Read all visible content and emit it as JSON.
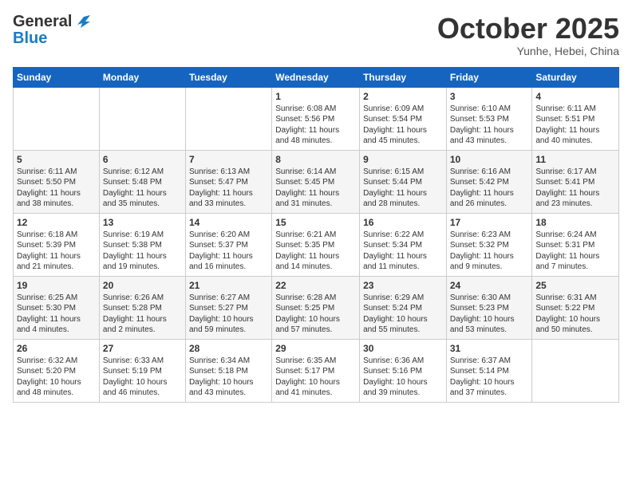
{
  "header": {
    "logo_line1": "General",
    "logo_line2": "Blue",
    "month": "October 2025",
    "location": "Yunhe, Hebei, China"
  },
  "weekdays": [
    "Sunday",
    "Monday",
    "Tuesday",
    "Wednesday",
    "Thursday",
    "Friday",
    "Saturday"
  ],
  "weeks": [
    [
      {
        "day": "",
        "info": ""
      },
      {
        "day": "",
        "info": ""
      },
      {
        "day": "",
        "info": ""
      },
      {
        "day": "1",
        "info": "Sunrise: 6:08 AM\nSunset: 5:56 PM\nDaylight: 11 hours\nand 48 minutes."
      },
      {
        "day": "2",
        "info": "Sunrise: 6:09 AM\nSunset: 5:54 PM\nDaylight: 11 hours\nand 45 minutes."
      },
      {
        "day": "3",
        "info": "Sunrise: 6:10 AM\nSunset: 5:53 PM\nDaylight: 11 hours\nand 43 minutes."
      },
      {
        "day": "4",
        "info": "Sunrise: 6:11 AM\nSunset: 5:51 PM\nDaylight: 11 hours\nand 40 minutes."
      }
    ],
    [
      {
        "day": "5",
        "info": "Sunrise: 6:11 AM\nSunset: 5:50 PM\nDaylight: 11 hours\nand 38 minutes."
      },
      {
        "day": "6",
        "info": "Sunrise: 6:12 AM\nSunset: 5:48 PM\nDaylight: 11 hours\nand 35 minutes."
      },
      {
        "day": "7",
        "info": "Sunrise: 6:13 AM\nSunset: 5:47 PM\nDaylight: 11 hours\nand 33 minutes."
      },
      {
        "day": "8",
        "info": "Sunrise: 6:14 AM\nSunset: 5:45 PM\nDaylight: 11 hours\nand 31 minutes."
      },
      {
        "day": "9",
        "info": "Sunrise: 6:15 AM\nSunset: 5:44 PM\nDaylight: 11 hours\nand 28 minutes."
      },
      {
        "day": "10",
        "info": "Sunrise: 6:16 AM\nSunset: 5:42 PM\nDaylight: 11 hours\nand 26 minutes."
      },
      {
        "day": "11",
        "info": "Sunrise: 6:17 AM\nSunset: 5:41 PM\nDaylight: 11 hours\nand 23 minutes."
      }
    ],
    [
      {
        "day": "12",
        "info": "Sunrise: 6:18 AM\nSunset: 5:39 PM\nDaylight: 11 hours\nand 21 minutes."
      },
      {
        "day": "13",
        "info": "Sunrise: 6:19 AM\nSunset: 5:38 PM\nDaylight: 11 hours\nand 19 minutes."
      },
      {
        "day": "14",
        "info": "Sunrise: 6:20 AM\nSunset: 5:37 PM\nDaylight: 11 hours\nand 16 minutes."
      },
      {
        "day": "15",
        "info": "Sunrise: 6:21 AM\nSunset: 5:35 PM\nDaylight: 11 hours\nand 14 minutes."
      },
      {
        "day": "16",
        "info": "Sunrise: 6:22 AM\nSunset: 5:34 PM\nDaylight: 11 hours\nand 11 minutes."
      },
      {
        "day": "17",
        "info": "Sunrise: 6:23 AM\nSunset: 5:32 PM\nDaylight: 11 hours\nand 9 minutes."
      },
      {
        "day": "18",
        "info": "Sunrise: 6:24 AM\nSunset: 5:31 PM\nDaylight: 11 hours\nand 7 minutes."
      }
    ],
    [
      {
        "day": "19",
        "info": "Sunrise: 6:25 AM\nSunset: 5:30 PM\nDaylight: 11 hours\nand 4 minutes."
      },
      {
        "day": "20",
        "info": "Sunrise: 6:26 AM\nSunset: 5:28 PM\nDaylight: 11 hours\nand 2 minutes."
      },
      {
        "day": "21",
        "info": "Sunrise: 6:27 AM\nSunset: 5:27 PM\nDaylight: 10 hours\nand 59 minutes."
      },
      {
        "day": "22",
        "info": "Sunrise: 6:28 AM\nSunset: 5:25 PM\nDaylight: 10 hours\nand 57 minutes."
      },
      {
        "day": "23",
        "info": "Sunrise: 6:29 AM\nSunset: 5:24 PM\nDaylight: 10 hours\nand 55 minutes."
      },
      {
        "day": "24",
        "info": "Sunrise: 6:30 AM\nSunset: 5:23 PM\nDaylight: 10 hours\nand 53 minutes."
      },
      {
        "day": "25",
        "info": "Sunrise: 6:31 AM\nSunset: 5:22 PM\nDaylight: 10 hours\nand 50 minutes."
      }
    ],
    [
      {
        "day": "26",
        "info": "Sunrise: 6:32 AM\nSunset: 5:20 PM\nDaylight: 10 hours\nand 48 minutes."
      },
      {
        "day": "27",
        "info": "Sunrise: 6:33 AM\nSunset: 5:19 PM\nDaylight: 10 hours\nand 46 minutes."
      },
      {
        "day": "28",
        "info": "Sunrise: 6:34 AM\nSunset: 5:18 PM\nDaylight: 10 hours\nand 43 minutes."
      },
      {
        "day": "29",
        "info": "Sunrise: 6:35 AM\nSunset: 5:17 PM\nDaylight: 10 hours\nand 41 minutes."
      },
      {
        "day": "30",
        "info": "Sunrise: 6:36 AM\nSunset: 5:16 PM\nDaylight: 10 hours\nand 39 minutes."
      },
      {
        "day": "31",
        "info": "Sunrise: 6:37 AM\nSunset: 5:14 PM\nDaylight: 10 hours\nand 37 minutes."
      },
      {
        "day": "",
        "info": ""
      }
    ]
  ]
}
